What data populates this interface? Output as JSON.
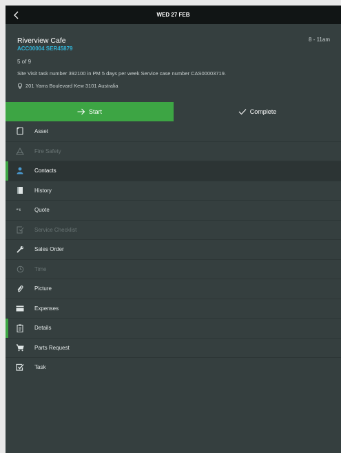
{
  "topbar": {
    "title": "WED 27 FEB"
  },
  "job": {
    "site_name": "Riverview Cafe",
    "time_range": "8 - 11am",
    "codes": "ACC00004 SER45879",
    "counter": "5 of 9",
    "description": "Site Visit task number 392100 in PM 5 days per week Service case number CAS00003719.",
    "address": "201 Yarra Boulevard Kew 3101 Australia"
  },
  "actions": {
    "start_label": "Start",
    "complete_label": "Complete"
  },
  "menu": {
    "items": [
      {
        "label": "Asset",
        "icon": "clipboard-icon",
        "state": "normal",
        "marker": false
      },
      {
        "label": "Fire Safety",
        "icon": "warning-icon",
        "state": "disabled",
        "marker": false
      },
      {
        "label": "Contacts",
        "icon": "person-icon",
        "state": "selected",
        "marker": true
      },
      {
        "label": "History",
        "icon": "book-icon",
        "state": "normal",
        "marker": false
      },
      {
        "label": "Quote",
        "icon": "quote-icon",
        "state": "normal",
        "marker": false
      },
      {
        "label": "Service Checklist",
        "icon": "checklist-icon",
        "state": "disabled",
        "marker": false
      },
      {
        "label": "Sales Order",
        "icon": "wrench-icon",
        "state": "normal",
        "marker": false
      },
      {
        "label": "Time",
        "icon": "clock-icon",
        "state": "disabled",
        "marker": false
      },
      {
        "label": "Picture",
        "icon": "paperclip-icon",
        "state": "normal",
        "marker": false
      },
      {
        "label": "Expenses",
        "icon": "card-icon",
        "state": "normal",
        "marker": false
      },
      {
        "label": "Details",
        "icon": "document-icon",
        "state": "normal",
        "marker": true
      },
      {
        "label": "Parts Request",
        "icon": "cart-icon",
        "state": "normal",
        "marker": false
      },
      {
        "label": "Task",
        "icon": "task-check-icon",
        "state": "normal",
        "marker": false
      }
    ]
  },
  "colors": {
    "background": "#353f3f",
    "topbar": "#111515",
    "accent_green": "#3da544",
    "link_blue": "#33b3d6"
  }
}
